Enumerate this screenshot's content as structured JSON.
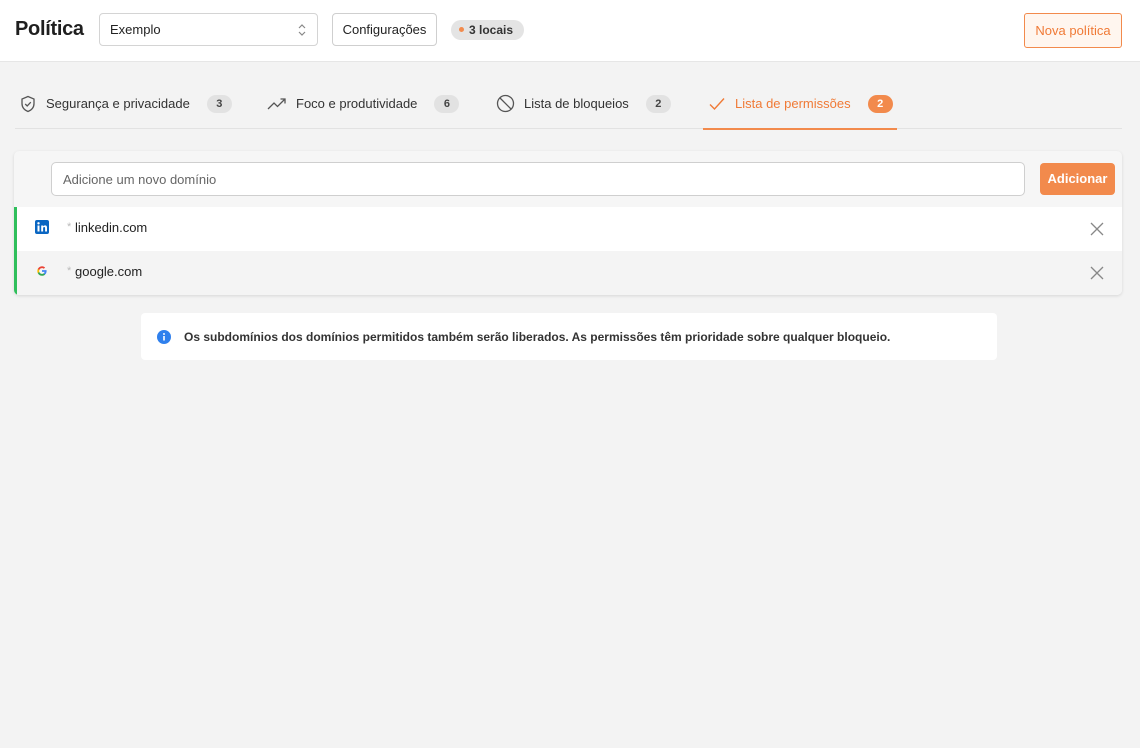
{
  "header": {
    "title": "Política",
    "select_value": "Exemplo",
    "config_label": "Configurações",
    "locais_label": "3 locais",
    "new_policy_label": "Nova política"
  },
  "tabs": [
    {
      "label": "Segurança e privacidade",
      "count": "3",
      "icon": "shield-check-icon",
      "active": false
    },
    {
      "label": "Foco e produtividade",
      "count": "6",
      "icon": "trending-up-icon",
      "active": false
    },
    {
      "label": "Lista de bloqueios",
      "count": "2",
      "icon": "block-icon",
      "active": false
    },
    {
      "label": "Lista de permissões",
      "count": "2",
      "icon": "check-icon",
      "active": true
    }
  ],
  "allowlist": {
    "input_placeholder": "Adicione um novo domínio",
    "add_label": "Adicionar",
    "items": [
      {
        "prefix": "*",
        "domain": "linkedin.com",
        "icon": "linkedin-icon"
      },
      {
        "prefix": "*",
        "domain": "google.com",
        "icon": "google-icon"
      }
    ]
  },
  "info": {
    "text": "Os subdomínios dos domínios permitidos também serão liberados. As permissões têm prioridade sobre qualquer bloqueio."
  },
  "colors": {
    "accent": "#f28a4c",
    "allowed": "#2fbf5b",
    "info": "#2f80ed"
  }
}
